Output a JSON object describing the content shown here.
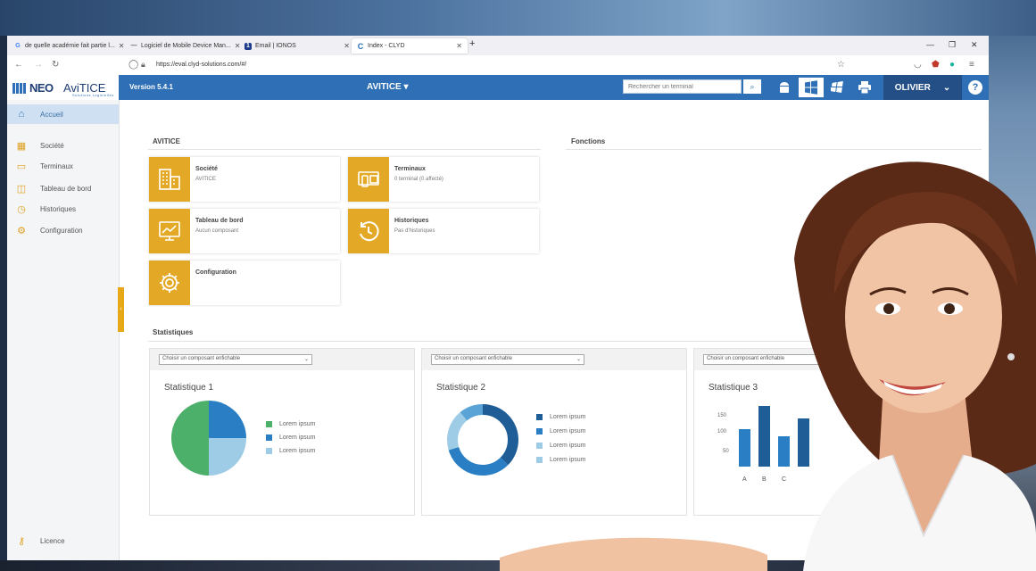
{
  "browser": {
    "tabs": [
      {
        "label": "de quelle académie fait partie l...",
        "favicon": "G",
        "color": "#4285f4"
      },
      {
        "label": "Logiciel de Mobile Device Man...",
        "favicon": "—",
        "color": "#555555"
      },
      {
        "label": "Email | IONOS",
        "favicon": "1",
        "color": "#1b3a8a"
      },
      {
        "label": "Index - CLYD",
        "favicon": "C",
        "color": "#2e6fb5"
      }
    ],
    "new_tab": "+",
    "url": "https://eval.clyd-solutions.com/#/"
  },
  "logo": {
    "neo": "NEO",
    "avitice": "AviTICE",
    "sub": "Solutions Logicielles"
  },
  "appbar": {
    "version": "Version 5.4.1",
    "title": "AVITICE ▾",
    "search_placeholder": "Rechercher un terminal",
    "user": "OLIVIER",
    "help": "?"
  },
  "sidebar": {
    "items": [
      {
        "label": "Accueil",
        "icon": "home-icon"
      },
      {
        "label": "Société",
        "icon": "building-icon"
      },
      {
        "label": "Terminaux",
        "icon": "devices-icon"
      },
      {
        "label": "Tableau de bord",
        "icon": "dashboard-icon"
      },
      {
        "label": "Historiques",
        "icon": "history-icon"
      },
      {
        "label": "Configuration",
        "icon": "gear-icon"
      }
    ],
    "licence": "Licence"
  },
  "main": {
    "section_avitice": "AVITICE",
    "section_fonctions": "Fonctions",
    "cards": [
      {
        "title": "Société",
        "subtitle": "AVITICE"
      },
      {
        "title": "Terminaux",
        "subtitle": "0 terminal (0 affecté)"
      },
      {
        "title": "Tableau de bord",
        "subtitle": "Aucun composant"
      },
      {
        "title": "Historiques",
        "subtitle": "Pas d'historiques"
      },
      {
        "title": "Configuration",
        "subtitle": ""
      }
    ],
    "section_stats": "Statistiques"
  },
  "stats": {
    "select_label": "Choisir un composant enfichable",
    "panels": [
      {
        "title": "Statistique 1",
        "legend": [
          "Lorem ipsum",
          "Lorem ipsum",
          "Lorem ipsum"
        ]
      },
      {
        "title": "Statistique 2",
        "legend": [
          "Lorem ipsum",
          "Lorem ipsum",
          "Lorem ipsum",
          "Lorem ipsum"
        ]
      },
      {
        "title": "Statistique 3"
      }
    ],
    "bar_axis": [
      "150",
      "100",
      "50"
    ],
    "bar_categories": [
      "A",
      "B",
      "C"
    ]
  },
  "colors": {
    "accent": "#e3a926",
    "primary": "#2e6fb5",
    "chart_green": "#4caf6a",
    "chart_blue": "#2a7fc4",
    "chart_light": "#9ecbe6",
    "chart_dark": "#1f5d96"
  }
}
